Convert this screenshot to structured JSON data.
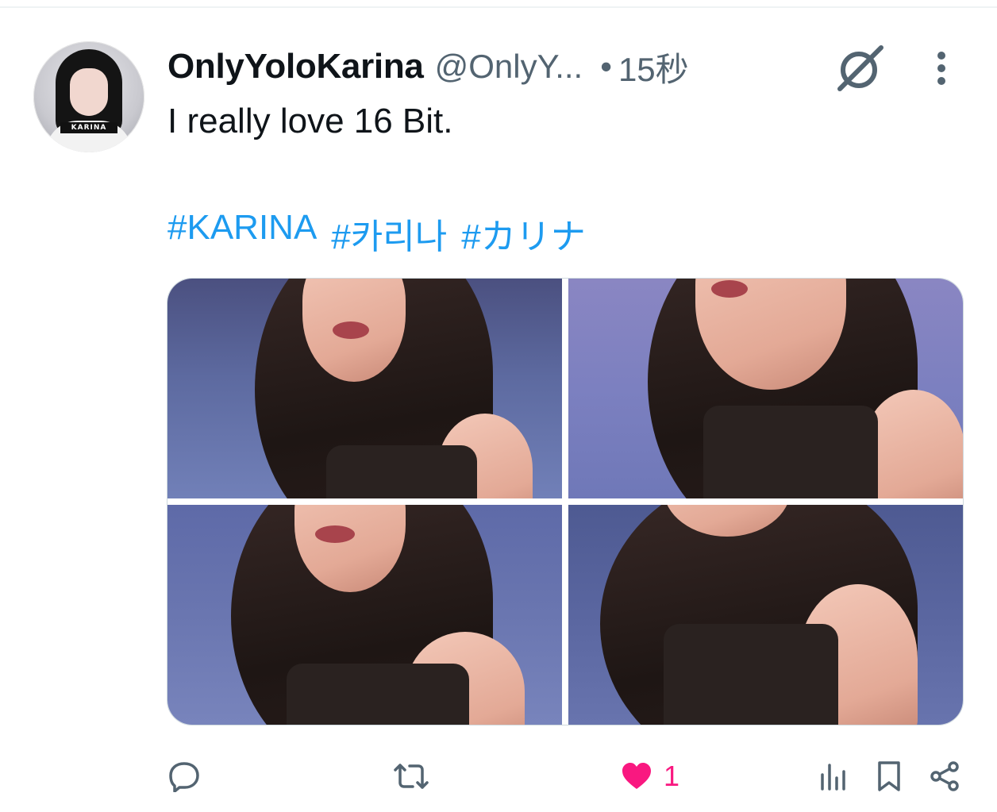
{
  "tweet": {
    "display_name": "OnlyYoloKarina",
    "handle": "@OnlyY...",
    "separator": "•",
    "timestamp": "15秒",
    "text": "I really love 16 Bit.",
    "hashtags": [
      "#KARINA",
      "#카리나",
      "#カリナ"
    ],
    "avatar_badge": "KARINA"
  },
  "media": [
    {
      "name": "photo-1"
    },
    {
      "name": "photo-2"
    },
    {
      "name": "photo-3"
    },
    {
      "name": "photo-4"
    }
  ],
  "actions": {
    "reply_icon": "reply-icon",
    "retweet_icon": "retweet-icon",
    "like_icon": "heart-filled-icon",
    "like_count": "1",
    "views_icon": "analytics-icon",
    "bookmark_icon": "bookmark-icon",
    "share_icon": "share-icon"
  },
  "colors": {
    "link": "#1d9bf0",
    "like": "#f91880",
    "muted": "#536471",
    "text": "#0f1419"
  }
}
